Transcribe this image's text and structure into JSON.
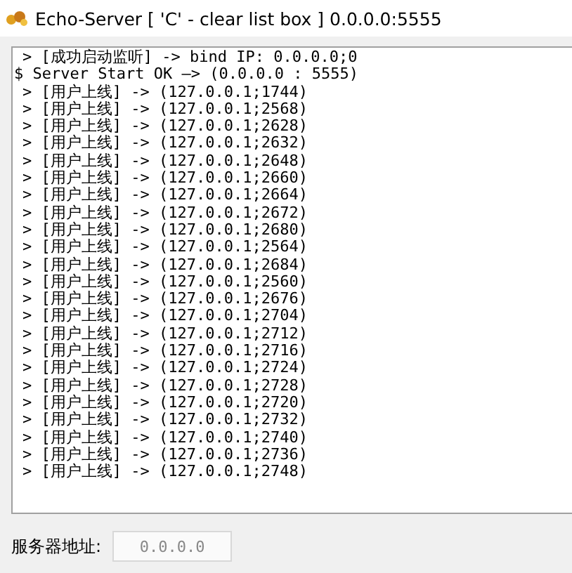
{
  "window": {
    "title": "Echo-Server [ 'C' - clear list box ] 0.0.0.0:5555"
  },
  "log": [
    {
      "kind": "event",
      "text": "> [成功启动监听] -> bind IP: 0.0.0.0;0"
    },
    {
      "kind": "status",
      "text": "$ Server Start OK —> (0.0.0.0 : 5555)"
    },
    {
      "kind": "event",
      "text": "> [用户上线] -> (127.0.0.1;1744)"
    },
    {
      "kind": "event",
      "text": "> [用户上线] -> (127.0.0.1;2568)"
    },
    {
      "kind": "event",
      "text": "> [用户上线] -> (127.0.0.1;2628)"
    },
    {
      "kind": "event",
      "text": "> [用户上线] -> (127.0.0.1;2632)"
    },
    {
      "kind": "event",
      "text": "> [用户上线] -> (127.0.0.1;2648)"
    },
    {
      "kind": "event",
      "text": "> [用户上线] -> (127.0.0.1;2660)"
    },
    {
      "kind": "event",
      "text": "> [用户上线] -> (127.0.0.1;2664)"
    },
    {
      "kind": "event",
      "text": "> [用户上线] -> (127.0.0.1;2672)"
    },
    {
      "kind": "event",
      "text": "> [用户上线] -> (127.0.0.1;2680)"
    },
    {
      "kind": "event",
      "text": "> [用户上线] -> (127.0.0.1;2564)"
    },
    {
      "kind": "event",
      "text": "> [用户上线] -> (127.0.0.1;2684)"
    },
    {
      "kind": "event",
      "text": "> [用户上线] -> (127.0.0.1;2560)"
    },
    {
      "kind": "event",
      "text": "> [用户上线] -> (127.0.0.1;2676)"
    },
    {
      "kind": "event",
      "text": "> [用户上线] -> (127.0.0.1;2704)"
    },
    {
      "kind": "event",
      "text": "> [用户上线] -> (127.0.0.1;2712)"
    },
    {
      "kind": "event",
      "text": "> [用户上线] -> (127.0.0.1;2716)"
    },
    {
      "kind": "event",
      "text": "> [用户上线] -> (127.0.0.1;2724)"
    },
    {
      "kind": "event",
      "text": "> [用户上线] -> (127.0.0.1;2728)"
    },
    {
      "kind": "event",
      "text": "> [用户上线] -> (127.0.0.1;2720)"
    },
    {
      "kind": "event",
      "text": "> [用户上线] -> (127.0.0.1;2732)"
    },
    {
      "kind": "event",
      "text": "> [用户上线] -> (127.0.0.1;2740)"
    },
    {
      "kind": "event",
      "text": "> [用户上线] -> (127.0.0.1;2736)"
    },
    {
      "kind": "event",
      "text": "> [用户上线] -> (127.0.0.1;2748)"
    }
  ],
  "server_address": {
    "label": "服务器地址:",
    "value": "0.0.0.0",
    "disabled": true
  }
}
